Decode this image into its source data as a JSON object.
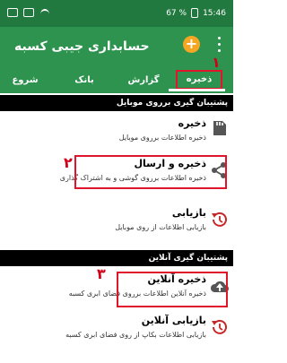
{
  "status": {
    "time": "15:46",
    "battery": "67 %"
  },
  "app": {
    "title": "حسابداری جیبی کسبه"
  },
  "tabs": [
    {
      "label": "ذخیره",
      "active": true
    },
    {
      "label": "گزارش"
    },
    {
      "label": "بانک"
    },
    {
      "label": "شروع"
    }
  ],
  "sections": {
    "mobile": "پشتیبان گیری برروی موبایل",
    "online": "پشتیبان گیری آنلاین"
  },
  "items": {
    "save": {
      "title": "ذخیره",
      "subtitle": "ذخیره اطلاعات برروی موبایل"
    },
    "save_send": {
      "title": "ذخیره و ارسال",
      "subtitle": "ذخیره اطلاعات برروی گوشی و به اشتراک گذاری"
    },
    "restore": {
      "title": "بازیابی",
      "subtitle": "بازیابی اطلاعات از روی موبایل"
    },
    "online_save": {
      "title": "ذخیره آنلاین",
      "subtitle": "ذخیره آنلاین اطلاعات برروی فضای ابری کسبه"
    },
    "online_restore": {
      "title": "بازیابی آنلاین",
      "subtitle": "بازیابی اطلاعات بکاپ از روی فضای ابری کسبه"
    }
  },
  "callouts": {
    "one": "۱",
    "two": "۲",
    "three": "۳"
  },
  "colors": {
    "statusbar": "#21793f",
    "appbar": "#2f9350",
    "highlight": "#e0142b",
    "accent": "#f5a623"
  }
}
